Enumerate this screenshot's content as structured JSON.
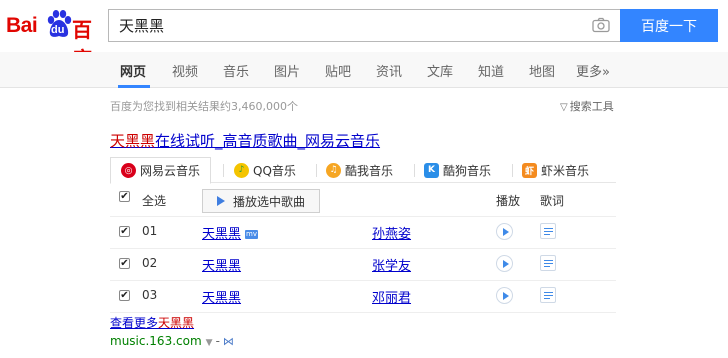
{
  "logo": {
    "text_left": "Bai",
    "paw_text": "du",
    "text_right": "百度"
  },
  "search": {
    "query": "天黑黑",
    "button_label": "百度一下"
  },
  "nav": {
    "tabs": [
      "网页",
      "视频",
      "音乐",
      "图片",
      "贴吧",
      "资讯",
      "文库",
      "知道",
      "地图",
      "更多»"
    ],
    "active_index": 0
  },
  "results": {
    "count_text": "百度为您找到相关结果约3,460,000个",
    "tools_label": "搜索工具",
    "title_highlight": "天黑黑",
    "title_rest": "在线试听_高音质歌曲_网易云音乐"
  },
  "music": {
    "sources": [
      "网易云音乐",
      "QQ音乐",
      "酷我音乐",
      "酷狗音乐",
      "虾米音乐"
    ],
    "select_all_label": "全选",
    "play_selected_label": "播放选中歌曲",
    "play_col": "播放",
    "lyric_col": "歌词",
    "songs": [
      {
        "num": "01",
        "title": "天黑黑",
        "singer": "孙燕姿",
        "mv": "mv"
      },
      {
        "num": "02",
        "title": "天黑黑",
        "singer": "张学友"
      },
      {
        "num": "03",
        "title": "天黑黑",
        "singer": "邓丽君"
      }
    ],
    "more_prefix": "查看更多",
    "more_highlight": "天黑黑",
    "source_url": "music.163.com",
    "source_dash": "-"
  },
  "colors": {
    "brand_red": "#e10601",
    "brand_blue": "#3385ff",
    "link": "#0000cc",
    "url_green": "#008000"
  }
}
